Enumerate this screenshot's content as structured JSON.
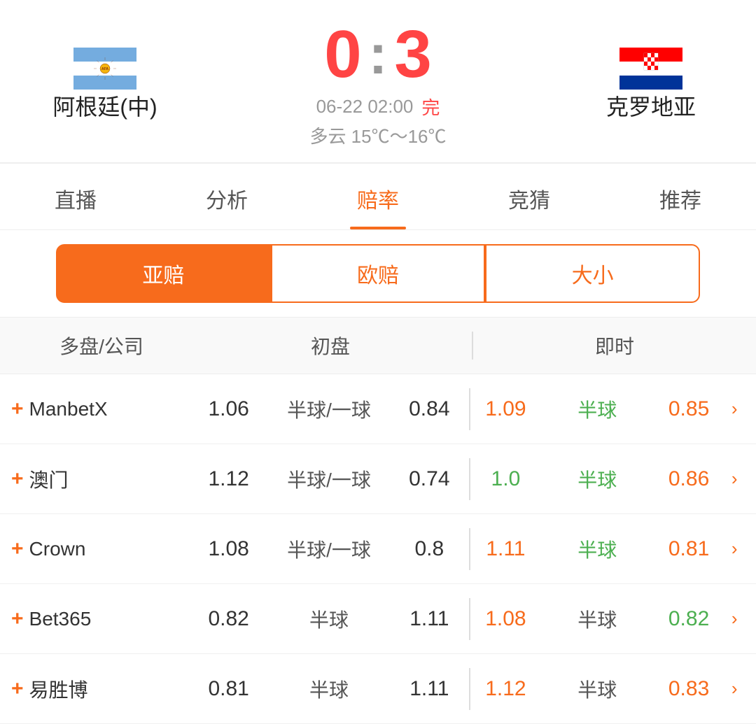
{
  "match": {
    "team_left": "阿根廷(中)",
    "team_right": "克罗地亚",
    "score": "0 : 3",
    "score_left": "0",
    "score_colon": ":",
    "score_right": "3",
    "date": "06-22 02:00",
    "status": "完",
    "weather": "多云  15℃～16℃"
  },
  "nav_tabs": [
    {
      "label": "直播",
      "active": false
    },
    {
      "label": "分析",
      "active": false
    },
    {
      "label": "赔率",
      "active": true
    },
    {
      "label": "竞猜",
      "active": false
    },
    {
      "label": "推荐",
      "active": false
    }
  ],
  "sub_tabs": [
    {
      "label": "亚赔",
      "active": true
    },
    {
      "label": "欧赔",
      "active": false
    },
    {
      "label": "大小",
      "active": false
    }
  ],
  "table": {
    "header": {
      "company_col": "多盘/公司",
      "initial_col": "初盘",
      "realtime_col": "即时"
    },
    "rows": [
      {
        "company": "ManbetX",
        "init_left": "1.06",
        "init_handicap": "半球/一球",
        "init_right": "0.84",
        "rt_left": "1.09",
        "rt_left_color": "orange",
        "rt_handicap": "半球",
        "rt_handicap_color": "green",
        "rt_right": "0.85",
        "rt_right_color": "orange"
      },
      {
        "company": "澳门",
        "init_left": "1.12",
        "init_handicap": "半球/一球",
        "init_right": "0.74",
        "rt_left": "1.0",
        "rt_left_color": "green",
        "rt_handicap": "半球",
        "rt_handicap_color": "green",
        "rt_right": "0.86",
        "rt_right_color": "orange"
      },
      {
        "company": "Crown",
        "init_left": "1.08",
        "init_handicap": "半球/一球",
        "init_right": "0.8",
        "rt_left": "1.11",
        "rt_left_color": "orange",
        "rt_handicap": "半球",
        "rt_handicap_color": "green",
        "rt_right": "0.81",
        "rt_right_color": "orange"
      },
      {
        "company": "Bet365",
        "init_left": "0.82",
        "init_handicap": "半球",
        "init_right": "1.11",
        "rt_left": "1.08",
        "rt_left_color": "orange",
        "rt_handicap": "半球",
        "rt_handicap_color": "normal",
        "rt_right": "0.82",
        "rt_right_color": "green"
      },
      {
        "company": "易胜博",
        "init_left": "0.81",
        "init_handicap": "半球",
        "init_right": "1.11",
        "rt_left": "1.12",
        "rt_left_color": "orange",
        "rt_handicap": "半球",
        "rt_handicap_color": "normal",
        "rt_right": "0.83",
        "rt_right_color": "orange"
      }
    ]
  },
  "icons": {
    "plus": "+",
    "arrow": "›"
  }
}
